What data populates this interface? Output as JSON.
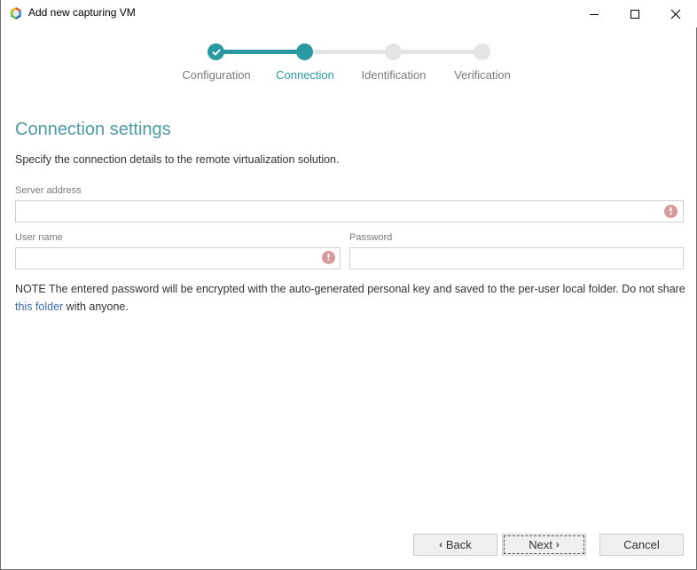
{
  "window": {
    "title": "Add new capturing VM",
    "controls": {
      "minimize_icon": "minimize-icon",
      "maximize_icon": "maximize-icon",
      "close_icon": "close-icon"
    }
  },
  "colors": {
    "accent": "#2a9aa2",
    "accent_text": "#4d9aa6",
    "step_inactive": "#e4e5e6",
    "label_inactive": "#7a7a7a",
    "error": "#d69a9a",
    "link": "#3c6fae"
  },
  "stepper": {
    "steps": [
      {
        "label": "Configuration",
        "state": "completed",
        "icon": "check-icon"
      },
      {
        "label": "Connection",
        "state": "active"
      },
      {
        "label": "Identification",
        "state": "pending"
      },
      {
        "label": "Verification",
        "state": "pending"
      }
    ]
  },
  "section": {
    "title": "Connection settings",
    "description": "Specify the connection details to the remote virtualization solution."
  },
  "form": {
    "server_address": {
      "label": "Server address",
      "value": "",
      "placeholder": "",
      "error_icon": "!"
    },
    "user_name": {
      "label": "User name",
      "value": "",
      "placeholder": "",
      "error_icon": "!"
    },
    "password": {
      "label": "Password",
      "value": "",
      "placeholder": ""
    }
  },
  "note": {
    "before_link": "NOTE The entered password will be encrypted with the auto-generated personal key and saved to the per-user local folder. Do not share ",
    "link_text": "this folder",
    "after_link": " with anyone."
  },
  "buttons": {
    "back": {
      "label": "Back",
      "icon": "‹"
    },
    "next": {
      "label": "Next",
      "icon": "›"
    },
    "cancel": {
      "label": "Cancel"
    }
  }
}
